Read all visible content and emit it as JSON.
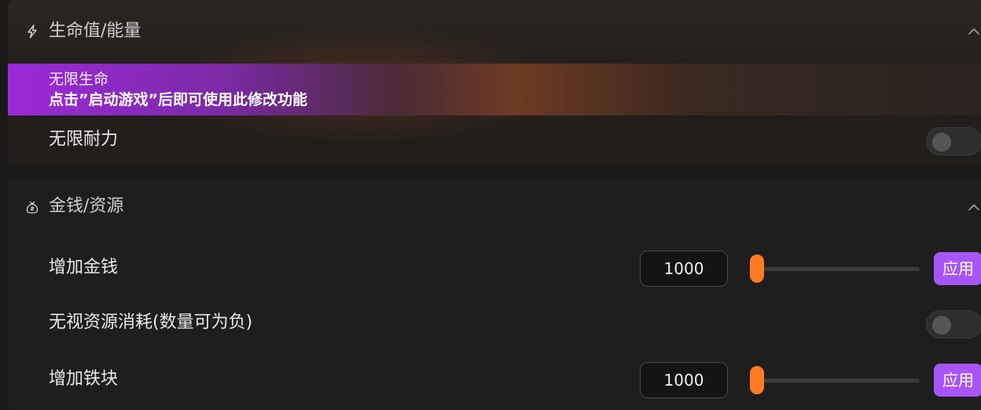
{
  "sections": [
    {
      "title": "生命值/能量",
      "icon": "lightning-icon",
      "collapsed": false,
      "banner": {
        "line1": "无限生命",
        "line2": "点击”启动游戏”后即可使用此修改功能"
      },
      "rows": [
        {
          "label": "无限耐力",
          "type": "toggle",
          "on": false
        }
      ]
    },
    {
      "title": "金钱/资源",
      "icon": "money-bag-icon",
      "collapsed": false,
      "rows": [
        {
          "label": "增加金钱",
          "type": "slider",
          "value": "1000",
          "slider_level": 0,
          "apply_label": "应用"
        },
        {
          "label": "无视资源消耗(数量可为负)",
          "type": "toggle",
          "on": false
        },
        {
          "label": "增加铁块",
          "type": "slider",
          "value": "1000",
          "slider_level": 0,
          "apply_label": "应用"
        }
      ]
    }
  ],
  "colors": {
    "accent_orange": "#ff7a21",
    "accent_purple": "#a855f7",
    "banner_purple": "#9b2ad8"
  }
}
